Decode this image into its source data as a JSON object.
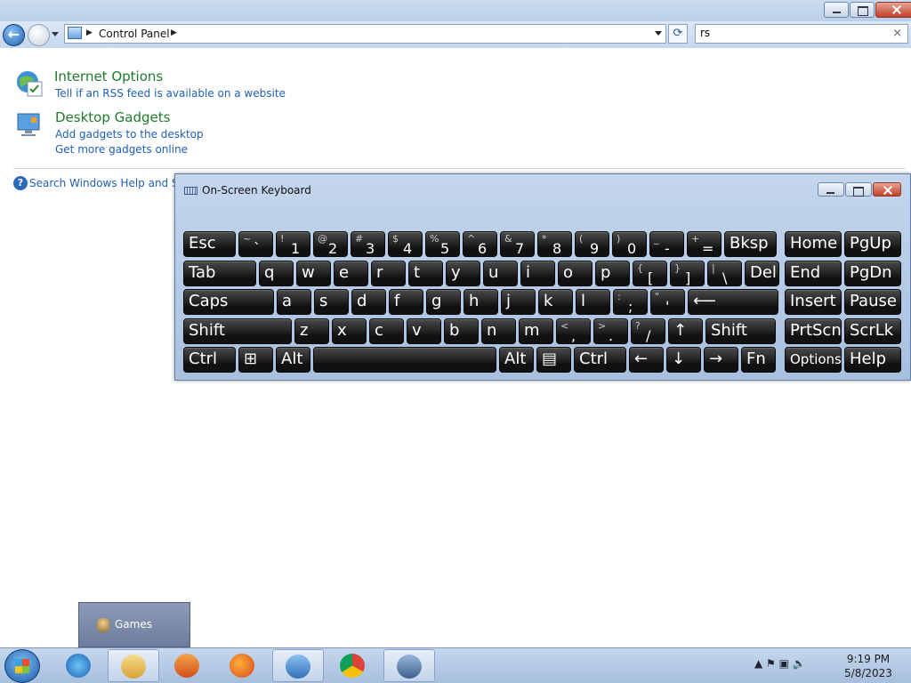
{
  "window": {
    "breadcrumb": [
      "Control Panel"
    ],
    "search_value": "rs",
    "search_clear_glyph": "×",
    "refresh_glyph": "⟳"
  },
  "results": [
    {
      "title": "Internet Options",
      "links": [
        "Tell if an RSS feed is available on a website"
      ],
      "icon": "internet-options-icon"
    },
    {
      "title": "Desktop Gadgets",
      "links": [
        "Add gadgets to the desktop",
        "Get more gadgets online"
      ],
      "icon": "desktop-gadgets-icon"
    }
  ],
  "help_link": "Search Windows Help and Sup",
  "osk": {
    "title": "On-Screen Keyboard",
    "rows": [
      [
        {
          "label": "Esc"
        },
        {
          "shift": "~",
          "base": "`"
        },
        {
          "shift": "!",
          "base": "1"
        },
        {
          "shift": "@",
          "base": "2"
        },
        {
          "shift": "#",
          "base": "3"
        },
        {
          "shift": "$",
          "base": "4"
        },
        {
          "shift": "%",
          "base": "5"
        },
        {
          "shift": "^",
          "base": "6"
        },
        {
          "shift": "&",
          "base": "7"
        },
        {
          "shift": "*",
          "base": "8"
        },
        {
          "shift": "(",
          "base": "9"
        },
        {
          "shift": ")",
          "base": "0"
        },
        {
          "shift": "_",
          "base": "-"
        },
        {
          "shift": "+",
          "base": "="
        },
        {
          "label": "Bksp"
        },
        {
          "label": "Home"
        },
        {
          "label": "PgUp"
        }
      ],
      [
        {
          "label": "Tab"
        },
        {
          "label": "q"
        },
        {
          "label": "w"
        },
        {
          "label": "e"
        },
        {
          "label": "r"
        },
        {
          "label": "t"
        },
        {
          "label": "y"
        },
        {
          "label": "u"
        },
        {
          "label": "i"
        },
        {
          "label": "o"
        },
        {
          "label": "p"
        },
        {
          "shift": "{",
          "base": "["
        },
        {
          "shift": "}",
          "base": "]"
        },
        {
          "shift": "|",
          "base": "\\"
        },
        {
          "label": "Del"
        },
        {
          "label": "End"
        },
        {
          "label": "PgDn"
        }
      ],
      [
        {
          "label": "Caps"
        },
        {
          "label": "a"
        },
        {
          "label": "s"
        },
        {
          "label": "d"
        },
        {
          "label": "f"
        },
        {
          "label": "g"
        },
        {
          "label": "h"
        },
        {
          "label": "j"
        },
        {
          "label": "k"
        },
        {
          "label": "l"
        },
        {
          "shift": ":",
          "base": ";"
        },
        {
          "shift": "\"",
          "base": "'"
        },
        {
          "label": "⟵",
          "name": "enter"
        },
        {
          "label": "Insert"
        },
        {
          "label": "Pause"
        }
      ],
      [
        {
          "label": "Shift",
          "name": "left-shift"
        },
        {
          "label": "z"
        },
        {
          "label": "x"
        },
        {
          "label": "c"
        },
        {
          "label": "v"
        },
        {
          "label": "b"
        },
        {
          "label": "n"
        },
        {
          "label": "m"
        },
        {
          "shift": "<",
          "base": ","
        },
        {
          "shift": ">",
          "base": "."
        },
        {
          "shift": "?",
          "base": "/"
        },
        {
          "label": "↑",
          "name": "up-arrow"
        },
        {
          "label": "Shift",
          "name": "right-shift"
        },
        {
          "label": "PrtScn"
        },
        {
          "label": "ScrLk"
        }
      ],
      [
        {
          "label": "Ctrl",
          "name": "left-ctrl"
        },
        {
          "label": "⊞",
          "name": "windows"
        },
        {
          "label": "Alt",
          "name": "left-alt"
        },
        {
          "label": "",
          "name": "space"
        },
        {
          "label": "Alt",
          "name": "right-alt"
        },
        {
          "label": "▤",
          "name": "menu"
        },
        {
          "label": "Ctrl",
          "name": "right-ctrl"
        },
        {
          "label": "←",
          "name": "left-arrow"
        },
        {
          "label": "↓",
          "name": "down-arrow"
        },
        {
          "label": "→",
          "name": "right-arrow"
        },
        {
          "label": "Fn"
        },
        {
          "label": "Options",
          "small": true
        },
        {
          "label": "Help"
        }
      ]
    ]
  },
  "taskbar": {
    "items": [
      "internet-explorer-icon",
      "windows-explorer-icon",
      "media-player-icon",
      "firefox-icon",
      "control-panel-icon",
      "chrome-icon",
      "on-screen-keyboard-icon"
    ],
    "open_items": [
      "windows-explorer-icon",
      "control-panel-icon",
      "on-screen-keyboard-icon"
    ],
    "tray_glyphs": "▲ ⚑ ▣ 🔈",
    "time": "9:19 PM",
    "date": "5/8/2023"
  },
  "jumplist": {
    "label": "Games"
  }
}
